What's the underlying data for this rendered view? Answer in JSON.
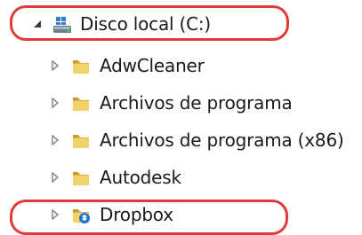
{
  "tree": {
    "root": {
      "label": "Disco local (C:)",
      "expanded": true,
      "icon": "drive-icon"
    },
    "children": [
      {
        "label": "AdwCleaner",
        "icon": "folder-icon"
      },
      {
        "label": "Archivos de programa",
        "icon": "folder-icon"
      },
      {
        "label": "Archivos de programa (x86)",
        "icon": "folder-icon"
      },
      {
        "label": "Autodesk",
        "icon": "folder-icon"
      },
      {
        "label": "Dropbox",
        "icon": "dropbox-folder-icon"
      }
    ]
  },
  "colors": {
    "highlight": "#e03a3a",
    "folder": "#e8c25a",
    "arrow": "#8a8a8a"
  }
}
